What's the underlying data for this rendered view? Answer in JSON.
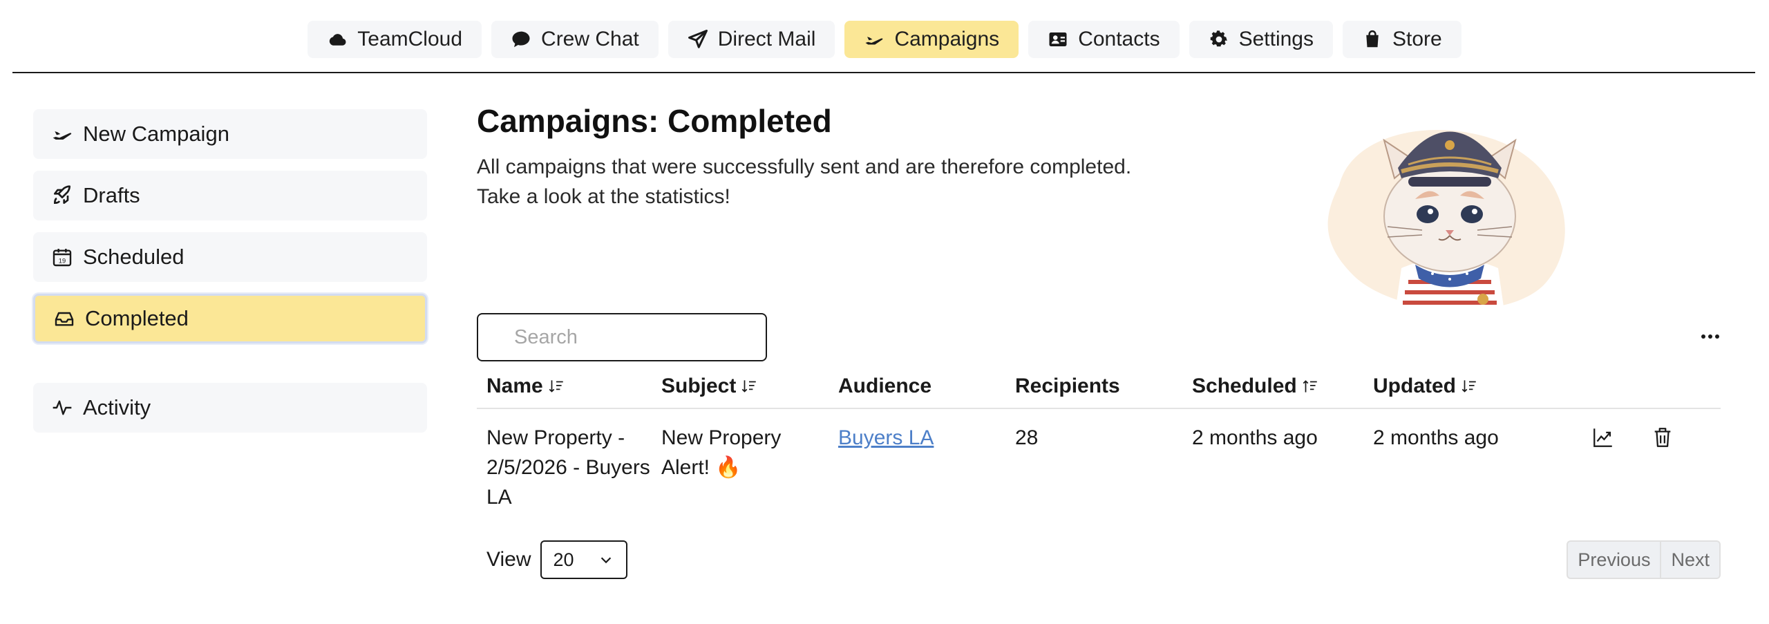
{
  "nav": {
    "tabs": [
      {
        "label": "TeamCloud",
        "icon": "cloud-icon"
      },
      {
        "label": "Crew Chat",
        "icon": "chat-bubble-icon"
      },
      {
        "label": "Direct Mail",
        "icon": "paper-plane-icon"
      },
      {
        "label": "Campaigns",
        "icon": "airplane-icon",
        "active": true
      },
      {
        "label": "Contacts",
        "icon": "contact-card-icon"
      },
      {
        "label": "Settings",
        "icon": "gear-icon"
      },
      {
        "label": "Store",
        "icon": "shopping-bag-icon"
      }
    ]
  },
  "sidebar": {
    "items": [
      {
        "label": "New Campaign",
        "icon": "airplane-icon"
      },
      {
        "label": "Drafts",
        "icon": "rocket-icon"
      },
      {
        "label": "Scheduled",
        "icon": "calendar-icon"
      },
      {
        "label": "Completed",
        "icon": "inbox-icon",
        "active": true
      },
      {
        "label": "Activity",
        "icon": "activity-pulse-icon"
      }
    ]
  },
  "main": {
    "title": "Campaigns: Completed",
    "description_line1": "All campaigns that were successfully sent and are therefore completed.",
    "description_line2": "Take a look at the statistics!",
    "search_placeholder": "Search",
    "columns": {
      "name": "Name",
      "subject": "Subject",
      "audience": "Audience",
      "recipients": "Recipients",
      "scheduled": "Scheduled",
      "updated": "Updated"
    },
    "rows": [
      {
        "name": "New Property - 2/5/2026 - Buyers LA",
        "subject": "New Propery Alert! 🔥",
        "audience": "Buyers LA",
        "recipients": "28",
        "scheduled": "2 months ago",
        "updated": "2 months ago"
      }
    ],
    "view_label": "View",
    "page_size": "20",
    "previous_label": "Previous",
    "next_label": "Next"
  },
  "colors": {
    "accent": "#fbe796",
    "tab_bg": "#f5f6f8",
    "link": "#4d7fc8"
  }
}
